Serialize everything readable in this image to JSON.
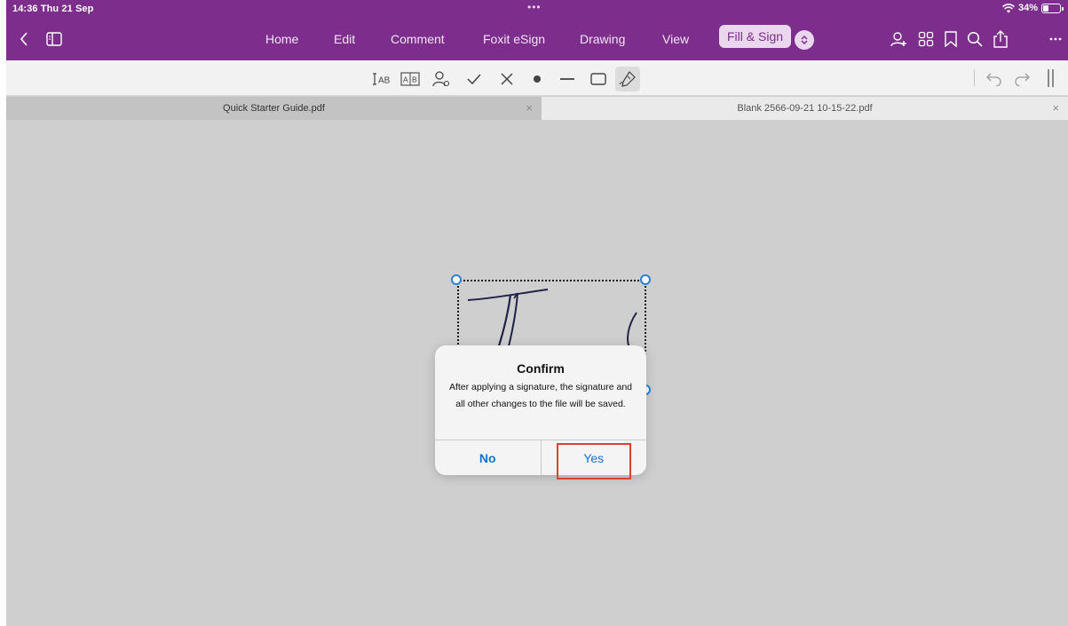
{
  "status_bar": {
    "time": "14:36  Thu 21 Sep",
    "dots": "•••",
    "battery": "34%",
    "battery_level": 0.34
  },
  "nav": {
    "tabs": [
      "Home",
      "Edit",
      "Comment",
      "Foxit eSign",
      "Drawing",
      "View"
    ],
    "active_tab": "Fill & Sign",
    "icons": [
      "back-icon",
      "sidebar-panel-icon",
      "switch-icon",
      "add-user-icon",
      "grid-icon",
      "bookmark-icon",
      "search-icon",
      "share-icon",
      "more-icon"
    ]
  },
  "toolbar": {
    "tools": [
      "text-ab-icon",
      "comb-text-icon",
      "profile-icon",
      "check-icon",
      "cross-icon",
      "dot-icon",
      "line-icon",
      "rectangle-icon",
      "signature-pen-icon"
    ],
    "right": [
      "undo-icon",
      "redo-icon"
    ]
  },
  "doc_tabs": [
    {
      "label": "Quick Starter Guide.pdf",
      "close": "×"
    },
    {
      "label": "Blank 2566-09-21 10-15-22.pdf",
      "close": "×"
    }
  ],
  "dialog": {
    "title": "Confirm",
    "message": "After applying a signature, the signature and all other changes to the file will be saved.",
    "no_label": "No",
    "yes_label": "Yes"
  },
  "colors": {
    "brand": "#7d2e8c",
    "link": "#1470d6",
    "highlight": "#d9403a",
    "handle": "#2f80d1"
  }
}
